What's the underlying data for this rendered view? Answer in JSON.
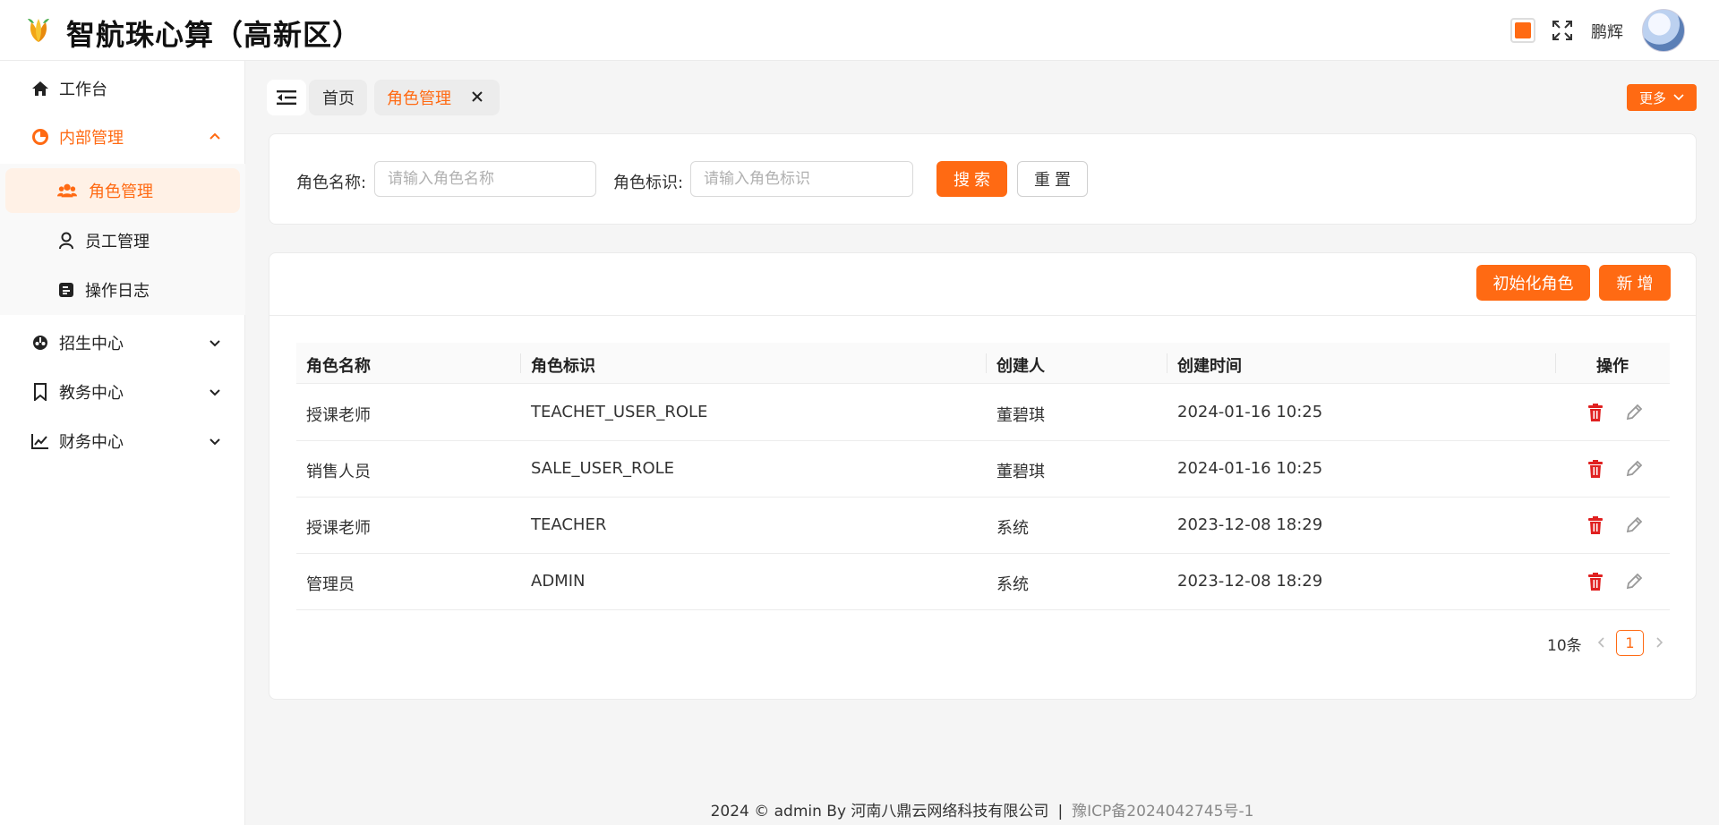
{
  "header": {
    "app_title": "智航珠心算（高新区）",
    "username": "鹏辉",
    "accent_color": "#ff6a13"
  },
  "sidebar": {
    "items": [
      {
        "label": "工作台",
        "icon": "home-icon"
      },
      {
        "label": "内部管理",
        "icon": "chart-circle-icon",
        "expanded": true,
        "children": [
          {
            "label": "角色管理",
            "icon": "users-icon",
            "active": true
          },
          {
            "label": "员工管理",
            "icon": "user-icon"
          },
          {
            "label": "操作日志",
            "icon": "log-icon"
          }
        ]
      },
      {
        "label": "招生中心",
        "icon": "recruit-icon"
      },
      {
        "label": "教务中心",
        "icon": "bookmark-icon"
      },
      {
        "label": "财务中心",
        "icon": "line-chart-icon"
      }
    ]
  },
  "tabs": {
    "home": "首页",
    "current": "角色管理",
    "more": "更多"
  },
  "search": {
    "role_name_label": "角色名称:",
    "role_name_placeholder": "请输入角色名称",
    "role_key_label": "角色标识:",
    "role_key_placeholder": "请输入角色标识",
    "search_button": "搜 索",
    "reset_button": "重 置"
  },
  "toolbar": {
    "init_button": "初始化角色",
    "add_button": "新 增"
  },
  "table": {
    "columns": [
      "角色名称",
      "角色标识",
      "创建人",
      "创建时间",
      "操作"
    ],
    "rows": [
      [
        "授课老师",
        "TEACHET_USER_ROLE",
        "董碧琪",
        "2024-01-16 10:25"
      ],
      [
        "销售人员",
        "SALE_USER_ROLE",
        "董碧琪",
        "2024-01-16 10:25"
      ],
      [
        "授课老师",
        "TEACHER",
        "系统",
        "2023-12-08 18:29"
      ],
      [
        "管理员",
        "ADMIN",
        "系统",
        "2023-12-08 18:29"
      ]
    ]
  },
  "pagination": {
    "page_size": "10条",
    "current_page": "1"
  },
  "footer": {
    "copyright": "2024 © admin By 河南八鼎云网络科技有限公司",
    "separator": "|",
    "icp": "豫ICP备2024042745号-1"
  }
}
